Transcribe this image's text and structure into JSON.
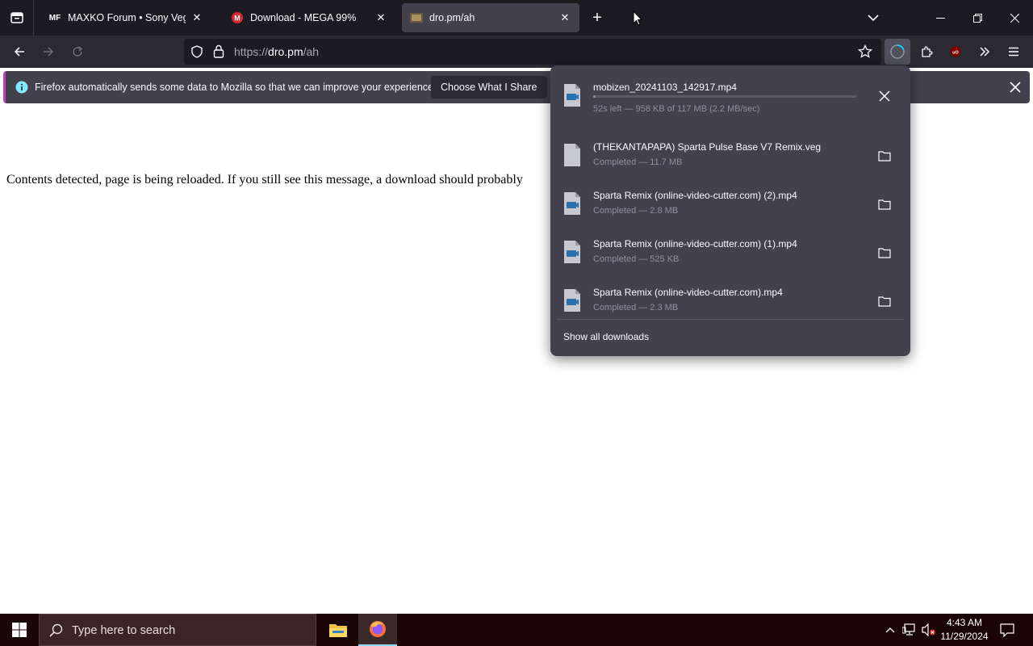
{
  "tabs": [
    {
      "label": "MAXKO Forum • Sony Vegas Pr",
      "favicon": "maxko-favicon"
    },
    {
      "label": "Download - MEGA 99%",
      "favicon": "mega-favicon"
    },
    {
      "label": "dro.pm/ah",
      "favicon": "site-favicon",
      "active": true
    }
  ],
  "url": {
    "scheme": "https://",
    "host": "dro.pm",
    "path": "/ah"
  },
  "notification": {
    "text": "Firefox automatically sends some data to Mozilla so that we can improve your experience.",
    "button": "Choose What I Share"
  },
  "page": {
    "message": "Contents detected, page is being reloaded. If you still see this message, a download should probably"
  },
  "downloads": {
    "items": [
      {
        "name": "mobizen_20241103_142917.mp4",
        "status": "52s left — 958 KB of 117 MB (2.2 MB/sec)",
        "in_progress": true,
        "progress": 0.008
      },
      {
        "name": "(THEKANTAPAPA) Sparta Pulse Base V7 Remix.veg",
        "status": "Completed — 11.7 MB"
      },
      {
        "name": "Sparta Remix (online-video-cutter.com) (2).mp4",
        "status": "Completed — 2.8 MB"
      },
      {
        "name": "Sparta Remix (online-video-cutter.com) (1).mp4",
        "status": "Completed — 525 KB"
      },
      {
        "name": "Sparta Remix (online-video-cutter.com).mp4",
        "status": "Completed — 2.3 MB"
      }
    ],
    "show_all": "Show all downloads"
  },
  "taskbar": {
    "search_placeholder": "Type here to search",
    "time": "4:43 AM",
    "date": "11/29/2024"
  },
  "colors": {
    "tabbar_bg": "#1c1b22",
    "toolbar_bg": "#2b2a33",
    "panel_bg": "#42414d",
    "taskbar_bg": "#1a0505",
    "mega_red": "#d9272e",
    "ublock_red": "#800000"
  }
}
